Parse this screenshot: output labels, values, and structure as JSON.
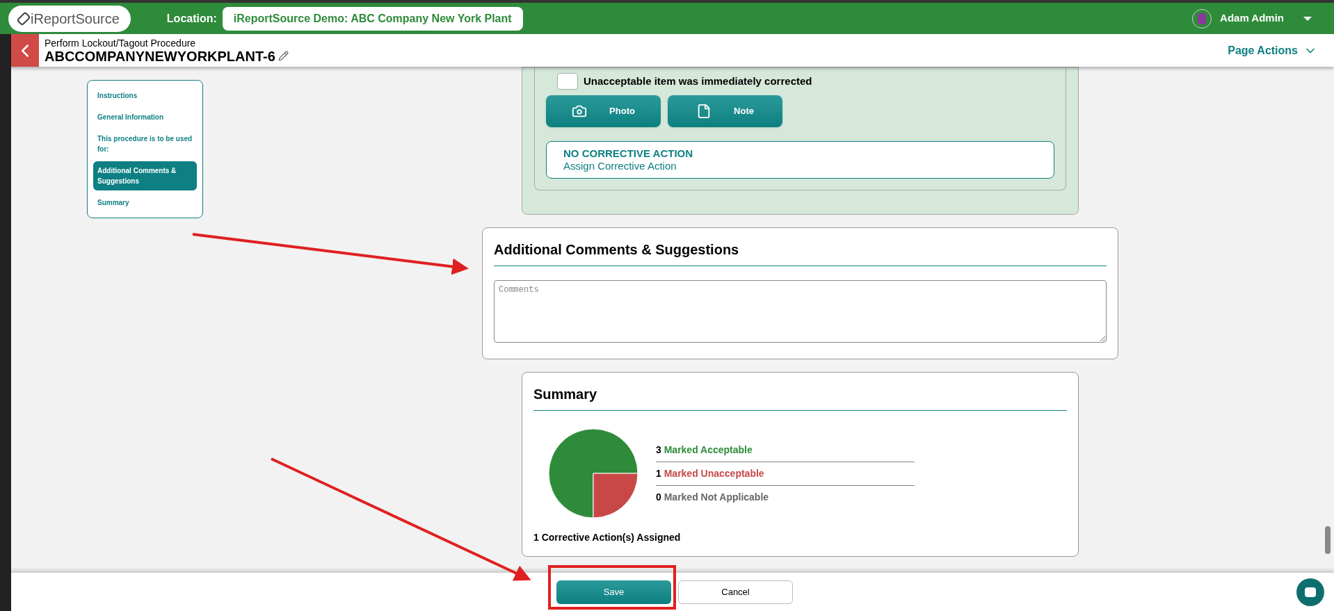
{
  "topbar": {
    "logo": "iReportSource",
    "location_label": "Location:",
    "location": "iReportSource Demo: ABC Company New York Plant",
    "user": "Adam Admin"
  },
  "page_header": {
    "subtitle": "Perform Lockout/Tagout Procedure",
    "title": "ABCCOMPANYNEWYORKPLANT-6",
    "actions": "Page Actions"
  },
  "nav": [
    {
      "label": "Instructions",
      "selected": false
    },
    {
      "label": "General Information",
      "selected": false
    },
    {
      "label": "This procedure is to be used for:",
      "selected": false
    },
    {
      "label": "Additional Comments & Suggestions",
      "selected": true
    },
    {
      "label": "Summary",
      "selected": false
    }
  ],
  "item_card": {
    "checkbox": {
      "label": "Unacceptable item was immediately corrected",
      "checked": false
    },
    "buttons": [
      {
        "kind": "photo",
        "label": "Photo"
      },
      {
        "kind": "note",
        "label": "Note"
      }
    ],
    "corrective": {
      "status": "NO CORRECTIVE ACTION",
      "link": "Assign Corrective Action"
    }
  },
  "comments": {
    "title": "Additional Comments & Suggestions",
    "placeholder": "Comments"
  },
  "summary": {
    "title": "Summary",
    "chart_data": {
      "type": "pie",
      "categories": [
        "Marked Acceptable",
        "Marked Unacceptable",
        "Marked Not Applicable"
      ],
      "values": [
        75,
        25,
        0
      ],
      "colors": [
        "#2e8b3a",
        "#c84848",
        "#666666"
      ]
    },
    "counts": [
      "3",
      "1",
      "0"
    ],
    "corrective_total": "1 Corrective Action(s) Assigned"
  },
  "footer": {
    "buttons": [
      {
        "kind": "primary",
        "label": "Save"
      },
      {
        "kind": "secondary",
        "label": "Cancel"
      }
    ]
  }
}
